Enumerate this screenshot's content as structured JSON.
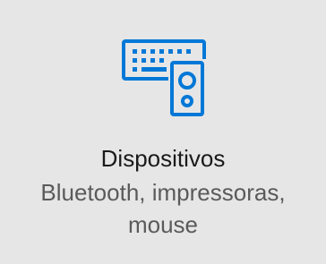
{
  "tile": {
    "title": "Dispositivos",
    "subtitle": "Bluetooth, impressoras, mouse",
    "icon": "devices-icon",
    "accent_color": "#0078d7"
  }
}
